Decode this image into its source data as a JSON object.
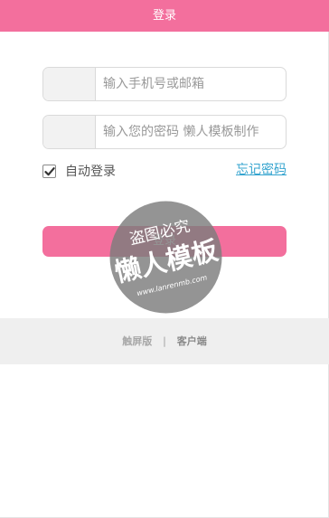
{
  "header": {
    "title": "登录"
  },
  "form": {
    "username_placeholder": "输入手机号或邮箱",
    "password_placeholder": "输入您的密码 懒人模板制作",
    "remember_label": "自动登录",
    "remember_checked": true,
    "forgot_label": "忘记密码",
    "login_label": "登录"
  },
  "footer": {
    "touch_label": "触屏版",
    "separator": "|",
    "client_label": "客户端"
  },
  "watermark": {
    "line1": "盗图必究",
    "line2": "懒人模板",
    "line3": "www.lanrenmb.com"
  },
  "colors": {
    "brand_pink": "#f36f9d",
    "link_blue": "#35a4cf",
    "footer_bg": "#efefef"
  }
}
